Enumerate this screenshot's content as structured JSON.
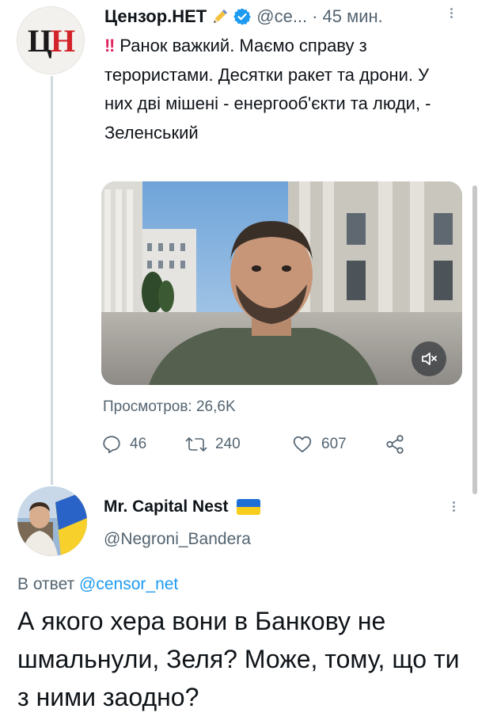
{
  "tweet": {
    "avatar_logo": {
      "letter1": "Ц",
      "letter2": "Н"
    },
    "author_name": "Цензор.НЕТ",
    "handle": "@се...",
    "separator": "·",
    "time": "45 мин.",
    "badges": [
      "writing-hand-icon",
      "verified-icon"
    ],
    "text": "Ранок важкий. Маємо справу з терористами. Десятки ракет та дрони. У них дві мішені - енергооб'єкти та люди, - Зеленський",
    "text_prefix": "‼",
    "video": {
      "mute_icon": "volume-mute-icon"
    },
    "views": "Просмотров: 26,6K",
    "actions": {
      "reply_count": "46",
      "retweet_count": "240",
      "like_count": "607"
    }
  },
  "reply": {
    "author_name": "Mr. Capital Nest",
    "handle": "@Negroni_Bandera",
    "reply_label": "В ответ",
    "reply_mention": "@censor_net",
    "text": "А якого хера вони в Банкову не шмальнули, Зеля? Може, тому, що ти з ними заодно?"
  },
  "colors": {
    "accent": "#1d9bf0",
    "secondary_text": "#536471",
    "logo_red": "#d2232a",
    "flag_blue": "#1d6fd6",
    "flag_yellow": "#f8cd1b"
  }
}
